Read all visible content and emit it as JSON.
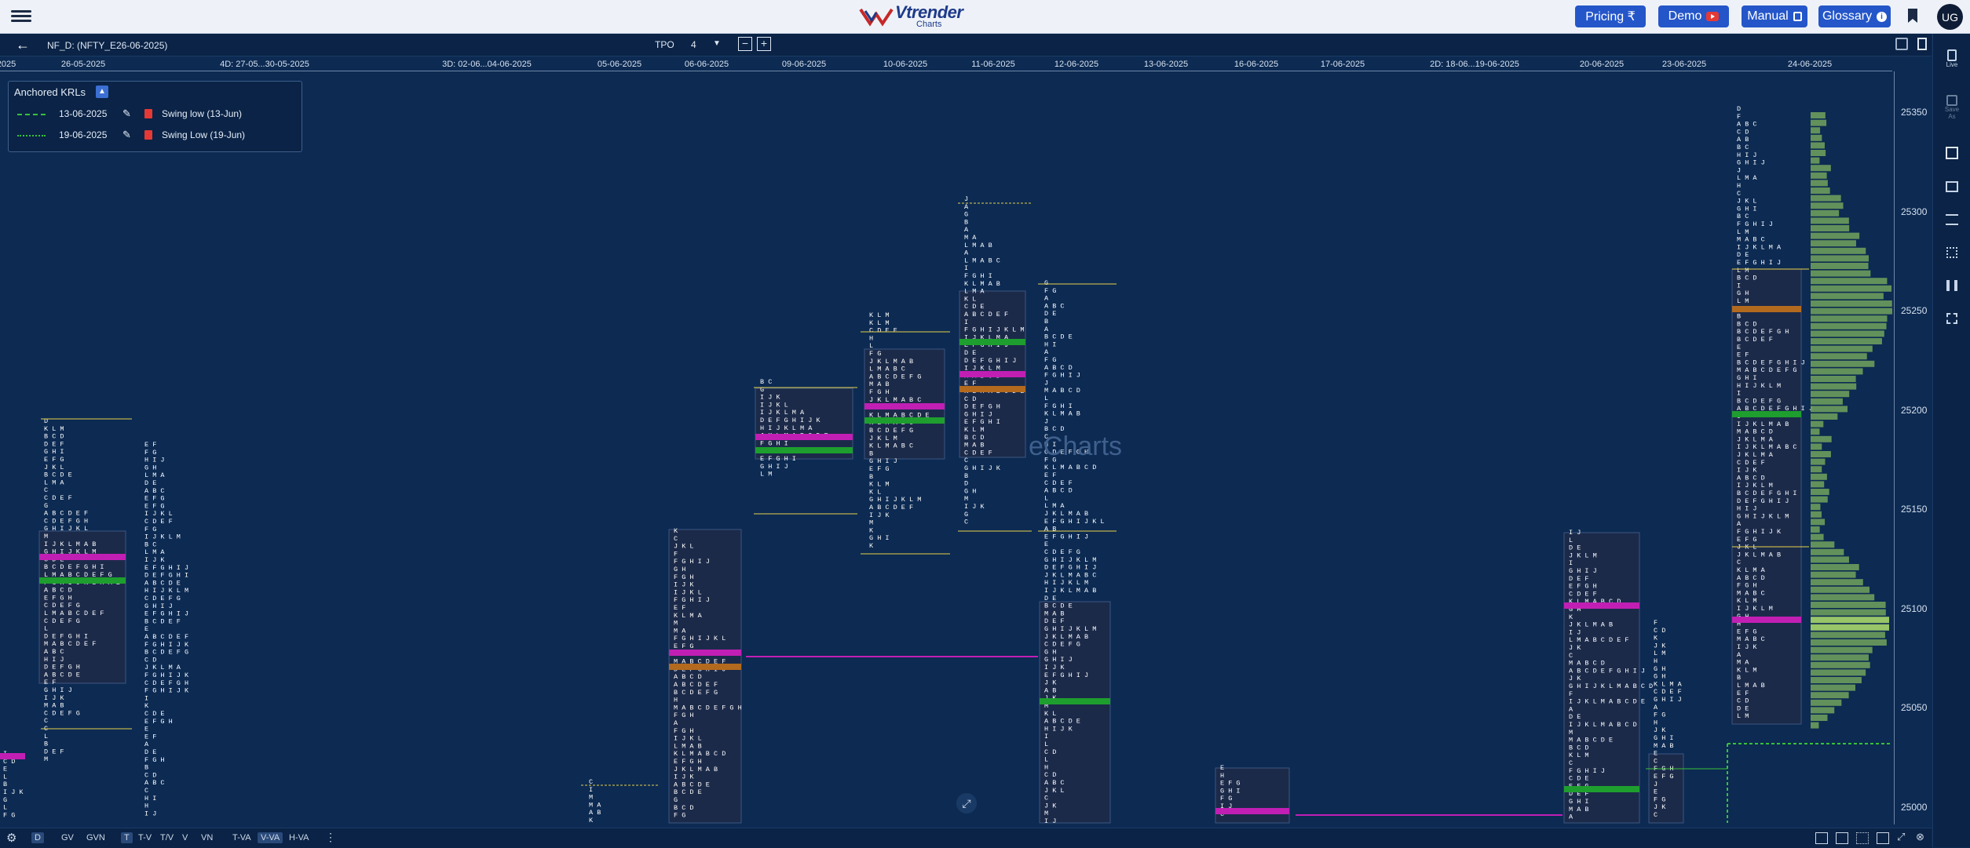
{
  "header": {
    "logo_text": "Vtrender",
    "logo_sub": "Charts",
    "buttons": [
      {
        "label": "Pricing ₹"
      },
      {
        "label": "Demo"
      },
      {
        "label": "Manual"
      },
      {
        "label": "Glossary"
      }
    ],
    "avatar": "UG",
    "colors": {
      "button_bg": "#2456c9",
      "demo_badge": "#e53935"
    }
  },
  "toolbar": {
    "symbol": "NF_D: (NFTY_E26-06-2025)",
    "tpo_label": "TPO",
    "tpo_value": "4",
    "minus": "−",
    "plus": "+"
  },
  "dates": [
    "2025",
    "26-05-2025",
    "4D: 27-05...30-05-2025",
    "3D: 02-06...04-06-2025",
    "05-06-2025",
    "06-06-2025",
    "09-06-2025",
    "10-06-2025",
    "11-06-2025",
    "12-06-2025",
    "13-06-2025",
    "16-06-2025",
    "17-06-2025",
    "2D: 18-06...19-06-2025",
    "20-06-2025",
    "23-06-2025",
    "24-06-2025"
  ],
  "prices": [
    "25350",
    "25300",
    "25250",
    "25200",
    "25150",
    "25100",
    "25050",
    "25000"
  ],
  "krl": {
    "title": "Anchored KRLs",
    "rows": [
      {
        "date": "13-06-2025",
        "name": "Swing low (13-Jun)",
        "color": "#37c237"
      },
      {
        "date": "19-06-2025",
        "name": "Swing Low (19-Jun)",
        "color": "#37c237"
      }
    ]
  },
  "watermark": "eCharts",
  "right_sidebar": {
    "live": "Live",
    "save_as": "Save As"
  },
  "bottom_tabs": [
    "D",
    "GV",
    "GVN",
    "T",
    "T-V",
    "T/V",
    "V",
    "VN",
    "T-VA",
    "V-VA",
    "H-VA"
  ],
  "colors": {
    "poc_magenta": "#c11fb4",
    "va_green": "#1e9e2e",
    "orange": "#b36a1e",
    "tpo_yellow": "#e8d24a",
    "profile_bg": "#1c2a4a",
    "volume_bar": "#6d9c5c"
  }
}
